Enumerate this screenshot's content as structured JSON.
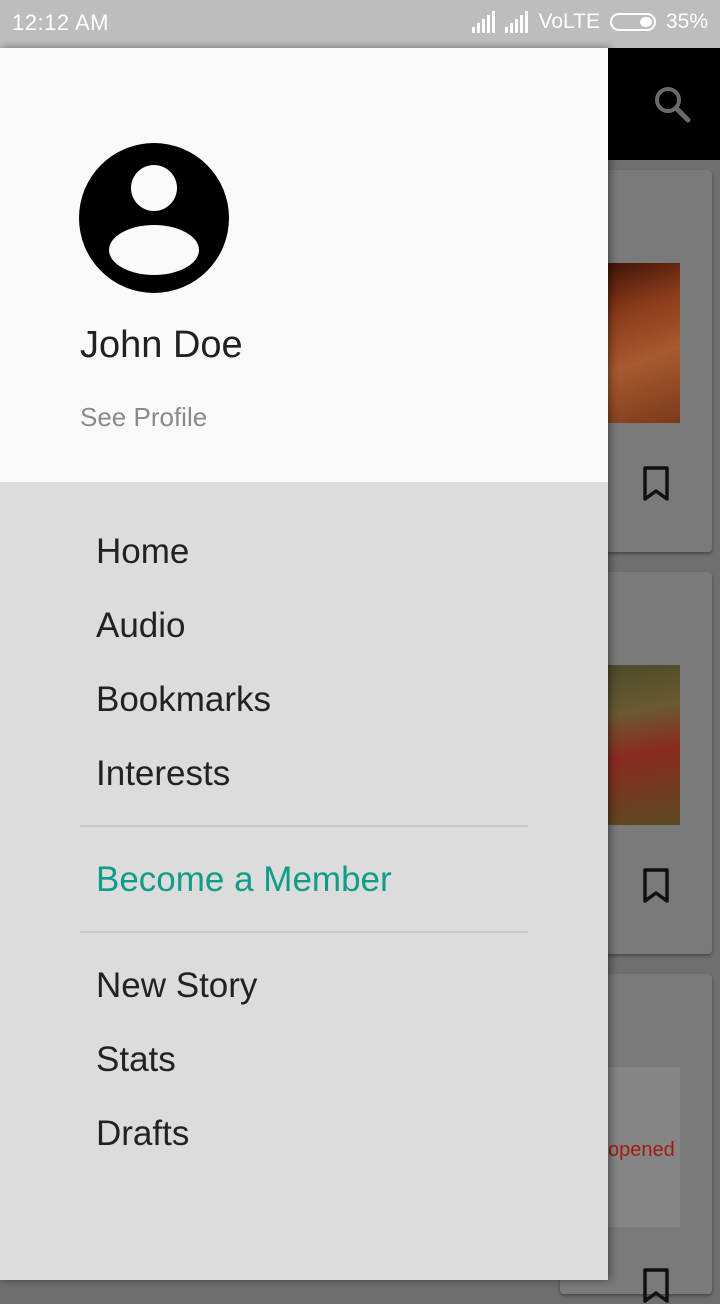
{
  "status_bar": {
    "time": "12:12 AM",
    "network": "VoLTE",
    "battery": "35%"
  },
  "drawer": {
    "user_name": "John Doe",
    "see_profile": "See Profile",
    "menu_group_1": [
      "Home",
      "Audio",
      "Bookmarks",
      "Interests"
    ],
    "member_cta": "Become a Member",
    "menu_group_2": [
      "New Story",
      "Stats",
      "Drafts"
    ]
  },
  "background": {
    "thumbnail_text": "opened"
  },
  "colors": {
    "accent": "#0f9d8a",
    "drawer_header": "#fafafa",
    "drawer_body": "#dcdcdc",
    "status_bar": "#bdbdbd"
  },
  "icons": [
    "avatar-icon",
    "search-icon",
    "bookmark-icon",
    "signal-icon",
    "battery-icon"
  ]
}
